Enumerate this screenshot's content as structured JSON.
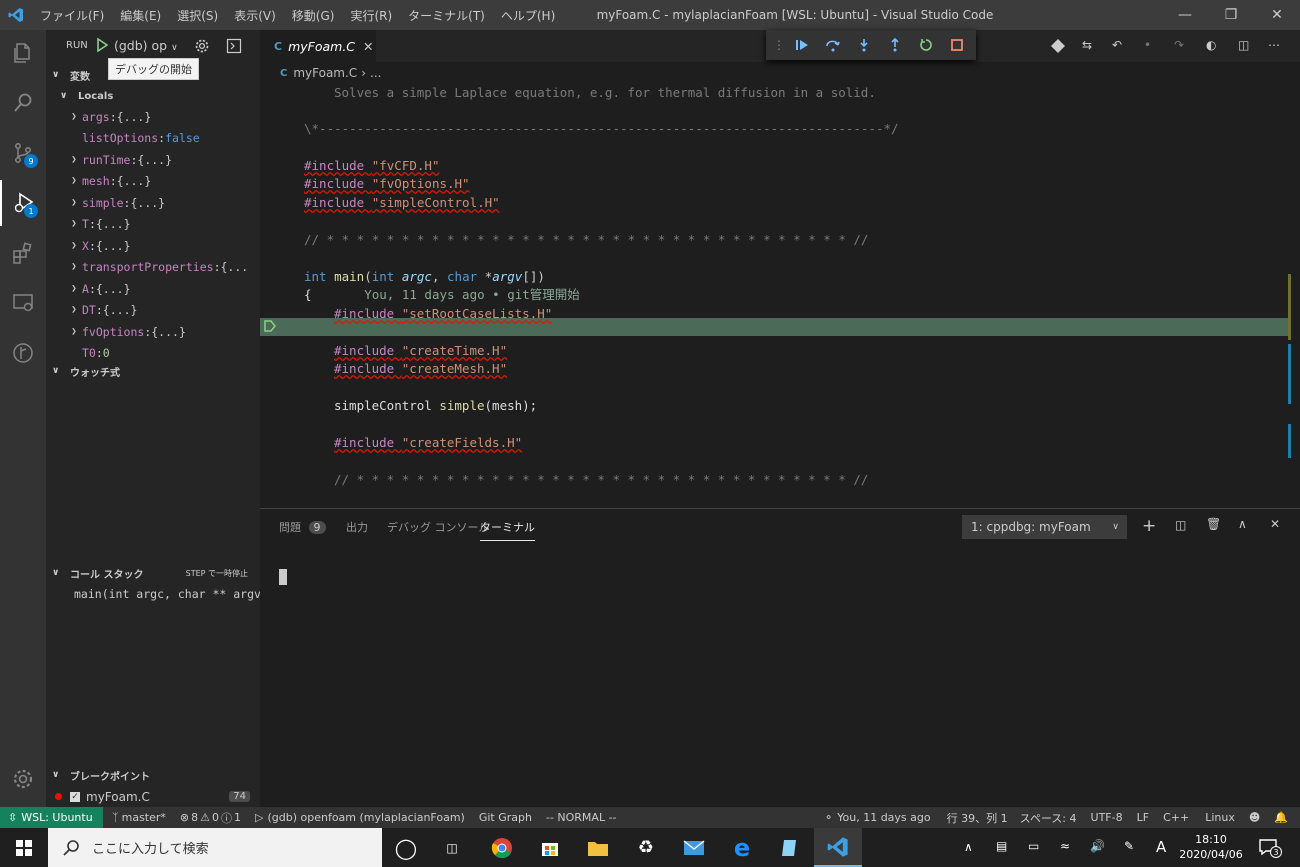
{
  "titlebar": {
    "menu": [
      "ファイル(F)",
      "編集(E)",
      "選択(S)",
      "表示(V)",
      "移動(G)",
      "実行(R)",
      "ターミナル(T)",
      "ヘルプ(H)"
    ],
    "title": "myFoam.C - mylaplacianFoam [WSL: Ubuntu] - Visual Studio Code"
  },
  "activity": {
    "scm_badge": "9",
    "debug_badge": "1"
  },
  "sidebar": {
    "run_label": "RUN",
    "config": "(gdb) op",
    "tooltip": "デバッグの開始",
    "variables_header": "変数",
    "locals_label": "Locals",
    "variables": [
      {
        "name": "args",
        "value": "{...}",
        "expandable": true
      },
      {
        "name": "listOptions",
        "value": "false",
        "expandable": false
      },
      {
        "name": "runTime",
        "value": "{...}",
        "expandable": true
      },
      {
        "name": "mesh",
        "value": "{...}",
        "expandable": true
      },
      {
        "name": "simple",
        "value": "{...}",
        "expandable": true
      },
      {
        "name": "T",
        "value": "{...}",
        "expandable": true
      },
      {
        "name": "X",
        "value": "{...}",
        "expandable": true
      },
      {
        "name": "transportProperties",
        "value": "{...",
        "expandable": true
      },
      {
        "name": "A",
        "value": "{...}",
        "expandable": true
      },
      {
        "name": "DT",
        "value": "{...}",
        "expandable": true
      },
      {
        "name": "fvOptions",
        "value": "{...}",
        "expandable": true
      },
      {
        "name": "T0",
        "value": "0",
        "expandable": false
      }
    ],
    "watch_header": "ウォッチ式",
    "callstack_header": "コール スタック",
    "callstack_status": "STEP で一時停止",
    "callstack_frame": "main(int argc, char ** argv",
    "breakpoints_header": "ブレークポイント",
    "breakpoint_file": "myFoam.C",
    "breakpoint_line": "74"
  },
  "editor": {
    "tab_label": "myFoam.C",
    "breadcrumb_file": "myFoam.C",
    "breadcrumb_rest": "...",
    "blame": "You, 11 days ago • git管理開始"
  },
  "panel": {
    "tabs": [
      "問題",
      "出力",
      "デバッグ コンソール",
      "ターミナル"
    ],
    "problems_count": "9",
    "terminal_select": "1: cppdbg: myFoam"
  },
  "statusbar": {
    "remote": "WSL: Ubuntu",
    "branch": "master*",
    "errors": "8",
    "warnings": "0",
    "infos": "1",
    "debug_config": "(gdb) openfoam (mylaplacianFoam)",
    "git_graph": "Git Graph",
    "vim_mode": "-- NORMAL --",
    "blame": "You, 11 days ago",
    "position": "行 39、列 1",
    "spaces": "スペース: 4",
    "encoding": "UTF-8",
    "eol": "LF",
    "language": "C++",
    "os": "Linux"
  },
  "taskbar": {
    "search_placeholder": "ここに入力して検索",
    "time": "18:10",
    "date": "2020/04/06",
    "ime": "A",
    "notif_count": "3"
  },
  "colors": {
    "accent": "#007acc",
    "debug_bar": "#007acc"
  }
}
